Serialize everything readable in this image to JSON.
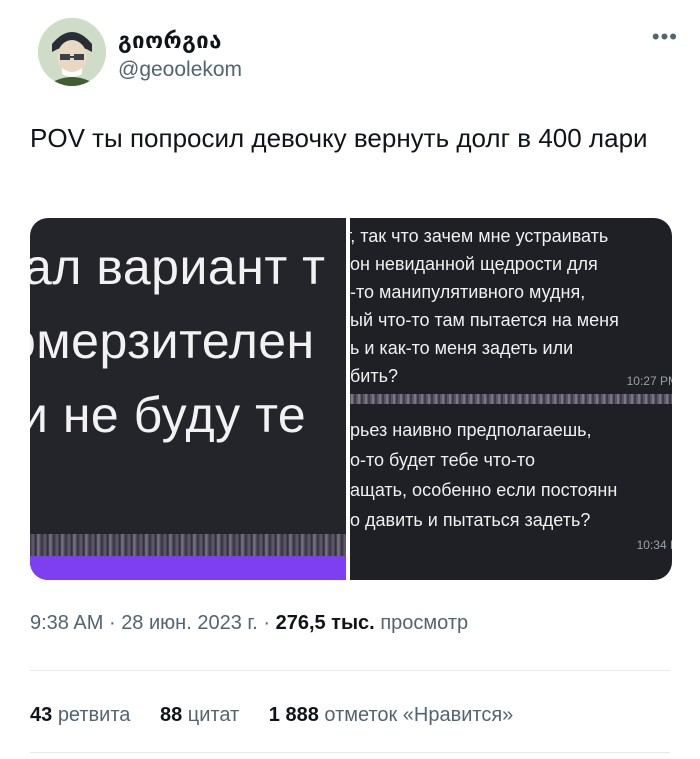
{
  "tweet": {
    "author_name": "გიორგია",
    "author_handle": "@geoolekom",
    "more_icon": "more-horizontal-icon",
    "text": "POV ты попросил девочку вернуть долг в 400 лари"
  },
  "media": {
    "left_lines": [
      "ал вариант т",
      "омерзителен",
      "и не буду те"
    ],
    "top_chat": {
      "lines": [
        "т, так что зачем мне устраивать",
        "он невиданной щедрости для",
        "-то манипулятивного мудня,",
        "ый что-то там пытается на меня",
        "ь и как-то меня задеть или",
        "бить?"
      ],
      "time": "10:27 PM"
    },
    "bottom_chat": {
      "lines": [
        "рьез наивно предполагаешь,",
        "о-то будет тебе что-то",
        "ащать, особенно если постоянн",
        "о давить и пытаться задеть?"
      ],
      "time": "10:34 P"
    },
    "accent_color": "#7e3ff2"
  },
  "meta": {
    "time": "9:38 AM",
    "separator": "·",
    "date": "28 июн. 2023 г.",
    "views_count": "276,5 тыс.",
    "views_label": "просмотр"
  },
  "stats": {
    "retweets_count": "43",
    "retweets_label": "ретвита",
    "quotes_count": "88",
    "quotes_label": "цитат",
    "likes_count": "1 888",
    "likes_label": "отметок «Нравится»"
  }
}
